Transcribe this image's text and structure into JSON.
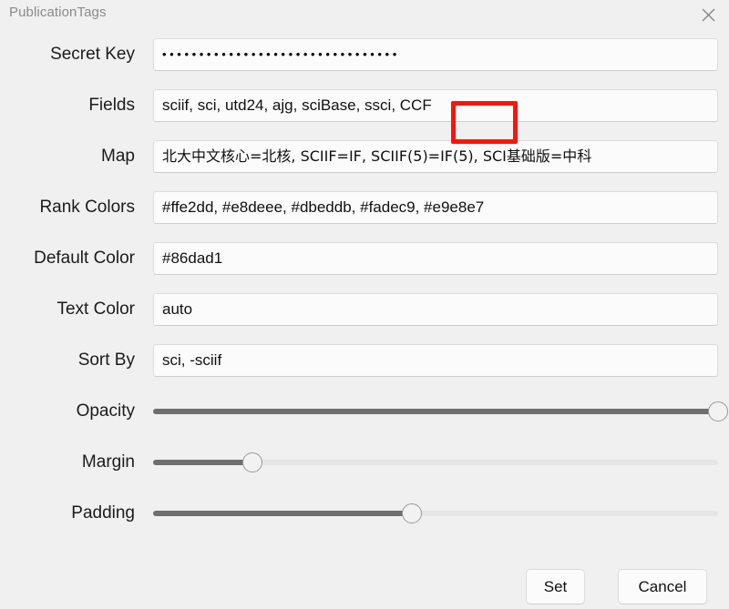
{
  "window": {
    "title": "PublicationTags",
    "close_icon": "close-icon",
    "background_color": "#f0f0f0"
  },
  "form": {
    "fields": [
      {
        "label": "Secret Key",
        "name": "secret-key",
        "kind": "password",
        "value": "••••••••••••••••••••••••••••••••",
        "placeholder": ""
      },
      {
        "label": "Fields",
        "name": "fields",
        "kind": "text",
        "value": "sciif, sci, utd24, ajg, sciBase, ssci, CCF",
        "placeholder": ""
      },
      {
        "label": "Map",
        "name": "map",
        "kind": "text",
        "value": "北大中文核心=北核, SCIIF=IF, SCIIF(5)=IF(5), SCI基础版=中科",
        "placeholder": ""
      },
      {
        "label": "Rank Colors",
        "name": "rank-colors",
        "kind": "text",
        "value": "#ffe2dd, #e8deee, #dbeddb, #fadec9, #e9e8e7",
        "placeholder": ""
      },
      {
        "label": "Default Color",
        "name": "default-color",
        "kind": "text",
        "value": "#86dad1",
        "placeholder": ""
      },
      {
        "label": "Text Color",
        "name": "text-color",
        "kind": "text",
        "value": "auto",
        "placeholder": ""
      },
      {
        "label": "Sort By",
        "name": "sort-by",
        "kind": "text",
        "value": "sci, -sciif",
        "placeholder": ""
      }
    ],
    "sliders": [
      {
        "label": "Opacity",
        "name": "opacity",
        "percent": 100
      },
      {
        "label": "Margin",
        "name": "margin",
        "percent": 17.6
      },
      {
        "label": "Padding",
        "name": "padding",
        "percent": 45.8
      }
    ]
  },
  "footer": {
    "set_label": "Set",
    "cancel_label": "Cancel"
  },
  "annotation": {
    "highlight_text": "CCF",
    "color": "#fc1505"
  }
}
